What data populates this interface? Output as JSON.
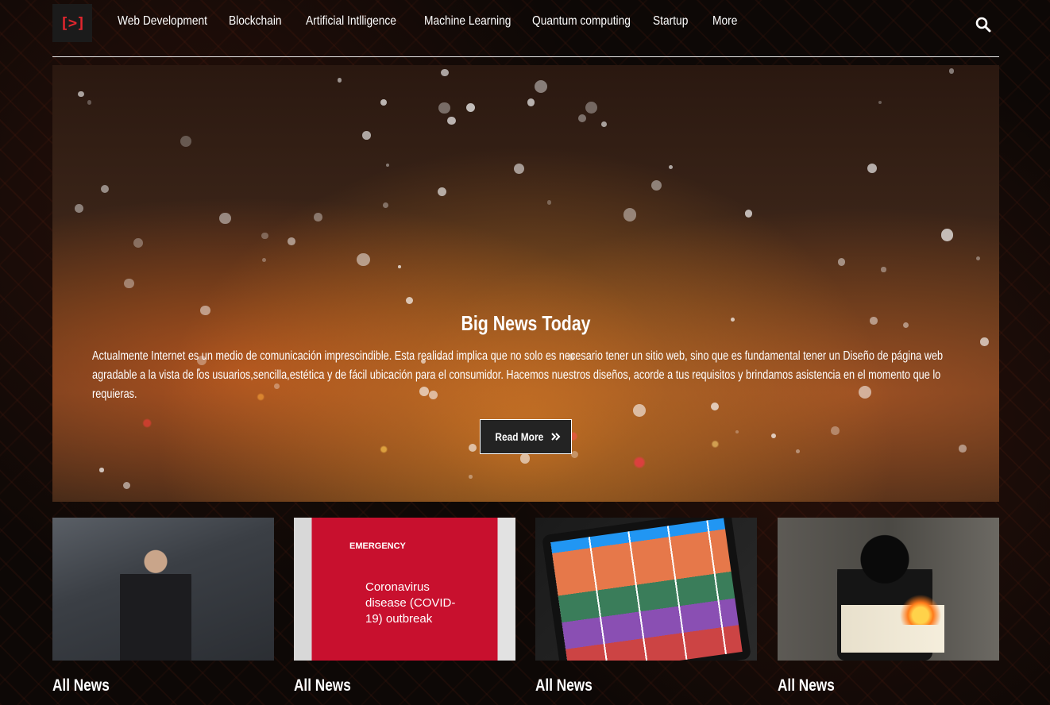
{
  "brand": {
    "logo_text": "[>]",
    "accent": "#e3262e"
  },
  "nav": {
    "items": [
      "Web Development",
      "Blockchain",
      "Artificial Intlligence",
      "Machine Learning",
      "Quantum computing",
      "Startup",
      "More"
    ],
    "search_icon": "search-icon"
  },
  "hero": {
    "title": "Big News Today",
    "text": "Actualmente Internet es un medio de comunicación imprescindible. Esta realidad implica que no solo es necesario tener un sitio web, sino que es fundamental tener un Diseño de página web agradable a la vista de los usuarios,sencilla,estética y de fácil ubicación para el consumidor. Hacemos nuestros diseños, acorde a tus requisitos y brindamos asistencia en el momento que lo requieras.",
    "button_label": "Read More",
    "button_icon": "angle-double-right-icon"
  },
  "cards": [
    {
      "caption": "All News"
    },
    {
      "caption": "All News",
      "image_text": [
        "EMERGENCY",
        "Coronavirus disease (COVID-19) outbreak"
      ]
    },
    {
      "caption": "All News"
    },
    {
      "caption": "All News"
    }
  ]
}
